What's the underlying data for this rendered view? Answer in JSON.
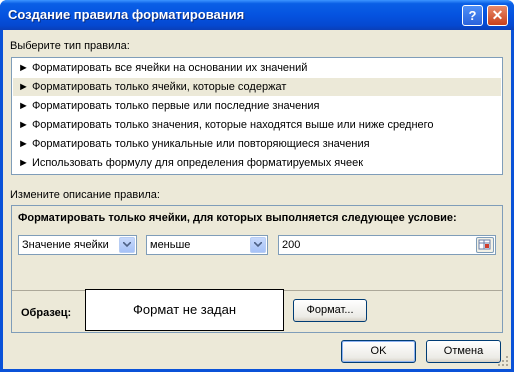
{
  "window": {
    "title": "Создание правила форматирования",
    "help_glyph": "?",
    "close_glyph": "✕"
  },
  "rule_type": {
    "label": "Выберите тип правила:",
    "items": [
      "► Форматировать все ячейки на основании их значений",
      "► Форматировать только ячейки, которые содержат",
      "► Форматировать только первые или последние значения",
      "► Форматировать только значения, которые находятся выше или ниже среднего",
      "► Форматировать только уникальные или повторяющиеся значения",
      "► Использовать формулу для определения форматируемых ячеек"
    ],
    "selected_index": 1
  },
  "description": {
    "label": "Измените описание правила:",
    "condition_title": "Форматировать только ячейки, для которых выполняется следующее условие:",
    "field1": "Значение ячейки",
    "operator": "меньше",
    "value": "200",
    "preview_label": "Образец:",
    "preview_text": "Формат не задан",
    "format_button": "Формат..."
  },
  "buttons": {
    "ok": "OK",
    "cancel": "Отмена"
  },
  "colors": {
    "titlebar": "#0553e0",
    "dialog_bg": "#ece9d8",
    "border": "#7f9db9"
  },
  "icons": [
    "help-icon",
    "close-icon",
    "chevron-down-icon",
    "range-select-icon",
    "resize-gripper-icon"
  ]
}
